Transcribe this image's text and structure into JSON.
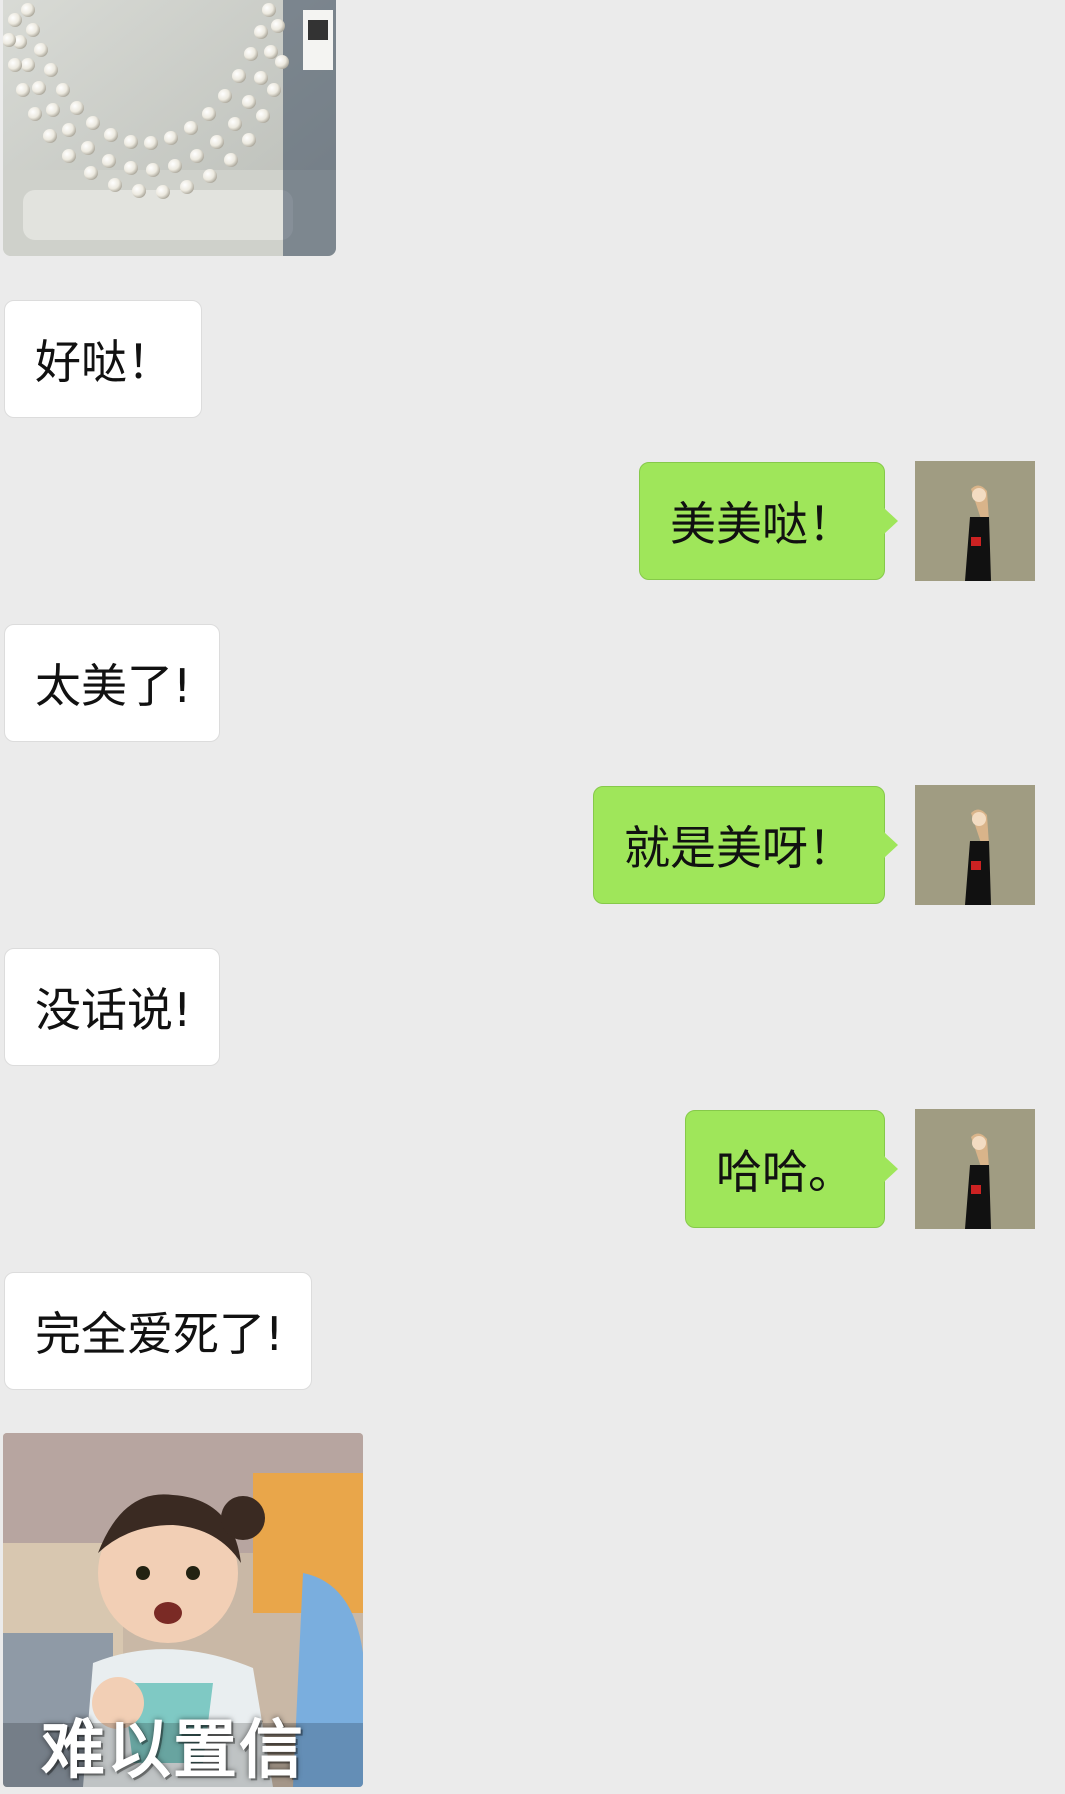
{
  "messages": {
    "m1": "好哒！",
    "m2": "美美哒！",
    "m3": "太美了!",
    "m4": "就是美呀！",
    "m5": "没话说!",
    "m6": "哈哈。",
    "m7": "完全爱死了!"
  },
  "sticker": {
    "caption": "难以置信"
  },
  "colors": {
    "background": "#ebebeb",
    "incoming_bubble": "#ffffff",
    "outgoing_bubble": "#9fe65a",
    "avatar_bg": "#a09c82"
  }
}
